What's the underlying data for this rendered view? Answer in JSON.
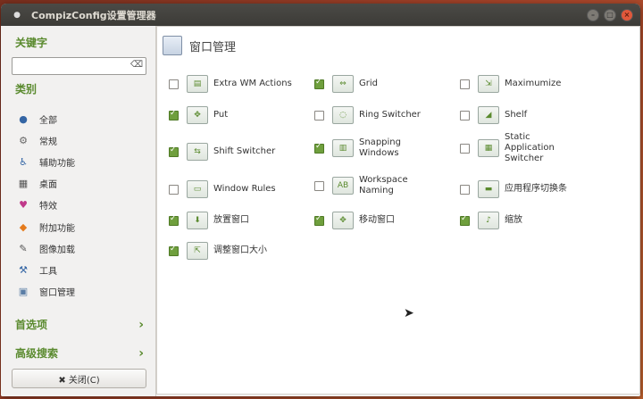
{
  "window": {
    "title": "CompizConfig设置管理器"
  },
  "sidebar": {
    "keyword_heading": "关键字",
    "search": {
      "value": "",
      "clear_icon": "clear-icon"
    },
    "category_heading": "类别",
    "categories": [
      {
        "label": "全部",
        "icon": "globe-icon"
      },
      {
        "label": "常规",
        "icon": "settings-icon"
      },
      {
        "label": "辅助功能",
        "icon": "accessibility-icon"
      },
      {
        "label": "桌面",
        "icon": "desktop-icon"
      },
      {
        "label": "特效",
        "icon": "effects-icon"
      },
      {
        "label": "附加功能",
        "icon": "extras-icon"
      },
      {
        "label": "图像加载",
        "icon": "image-loading-icon"
      },
      {
        "label": "工具",
        "icon": "tools-icon"
      },
      {
        "label": "窗口管理",
        "icon": "window-management-icon"
      }
    ],
    "preferences_label": "首选项",
    "advanced_search_label": "高级搜索",
    "close_button_label": "✖ 关闭(C)"
  },
  "main": {
    "title": "窗口管理",
    "plugins": [
      {
        "label": "Extra WM Actions",
        "checked": false
      },
      {
        "label": "Grid",
        "checked": true
      },
      {
        "label": "Maximumize",
        "checked": false
      },
      {
        "label": "Put",
        "checked": true
      },
      {
        "label": "Ring Switcher",
        "checked": false
      },
      {
        "label": "Shelf",
        "checked": false
      },
      {
        "label": "Shift Switcher",
        "checked": true
      },
      {
        "label": "Snapping Windows",
        "checked": true
      },
      {
        "label": "Static Application Switcher",
        "checked": false
      },
      {
        "label": "Window Rules",
        "checked": false
      },
      {
        "label": "Workspace Naming",
        "checked": false
      },
      {
        "label": "应用程序切换条",
        "checked": false
      },
      {
        "label": "放置窗口",
        "checked": true
      },
      {
        "label": "移动窗口",
        "checked": true
      },
      {
        "label": "缩放",
        "checked": true
      },
      {
        "label": "调整窗口大小",
        "checked": true
      }
    ]
  }
}
